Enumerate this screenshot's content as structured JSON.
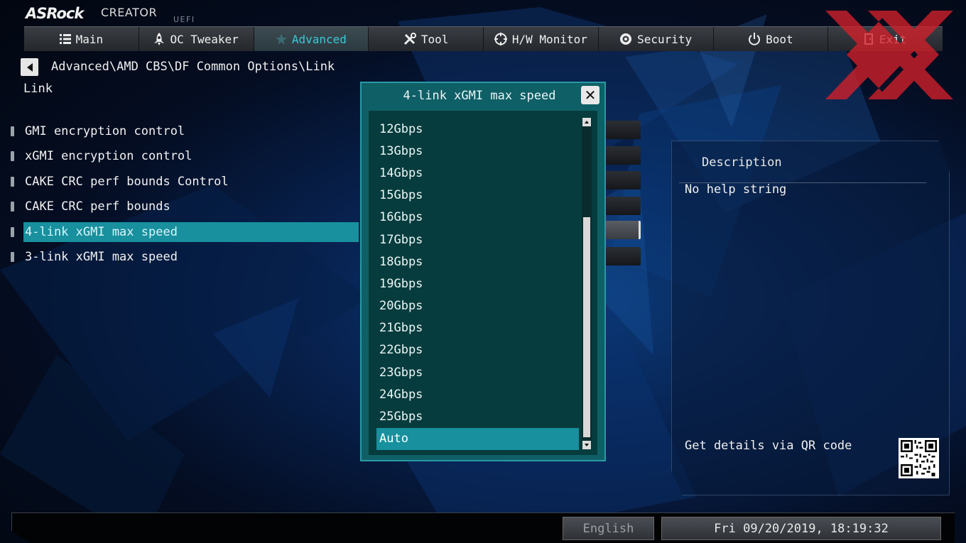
{
  "brand": {
    "name": "ASRock",
    "product": "CREATOR",
    "firmware": "UEFI"
  },
  "tabs": [
    {
      "label": "Main",
      "icon": "list-icon",
      "active": false
    },
    {
      "label": "OC Tweaker",
      "icon": "rocket-icon",
      "active": false
    },
    {
      "label": "Advanced",
      "icon": "star-icon",
      "active": true
    },
    {
      "label": "Tool",
      "icon": "tools-icon",
      "active": false
    },
    {
      "label": "H/W Monitor",
      "icon": "monitor-crosshair-icon",
      "active": false
    },
    {
      "label": "Security",
      "icon": "shield-icon",
      "active": false
    },
    {
      "label": "Boot",
      "icon": "power-icon",
      "active": false
    },
    {
      "label": "Exit",
      "icon": "exit-icon",
      "active": false
    }
  ],
  "breadcrumb": "Advanced\\AMD CBS\\DF Common Options\\Link",
  "section_title": "Link",
  "options": [
    {
      "label": "GMI encryption control",
      "selected": false
    },
    {
      "label": "xGMI encryption control",
      "selected": false
    },
    {
      "label": "CAKE CRC perf bounds Control",
      "selected": false
    },
    {
      "label": "CAKE CRC perf bounds",
      "selected": false
    },
    {
      "label": "4-link xGMI max speed",
      "selected": true
    },
    {
      "label": "3-link xGMI max speed",
      "selected": false
    }
  ],
  "popup": {
    "title": "4-link xGMI max speed",
    "items": [
      "12Gbps",
      "13Gbps",
      "14Gbps",
      "15Gbps",
      "16Gbps",
      "17Gbps",
      "18Gbps",
      "19Gbps",
      "20Gbps",
      "21Gbps",
      "22Gbps",
      "23Gbps",
      "24Gbps",
      "25Gbps",
      "Auto"
    ],
    "selected": "Auto"
  },
  "description": {
    "title": "Description",
    "text": "No help string",
    "qr_label": "Get details via QR code"
  },
  "footer": {
    "language": "English",
    "datetime": "Fri 09/20/2019, 18:19:32"
  },
  "colors": {
    "accent": "#18909e",
    "active_tab_text": "#3cc7d7",
    "popup_bg": "#0f5f66",
    "list_bg": "#063c3d"
  }
}
